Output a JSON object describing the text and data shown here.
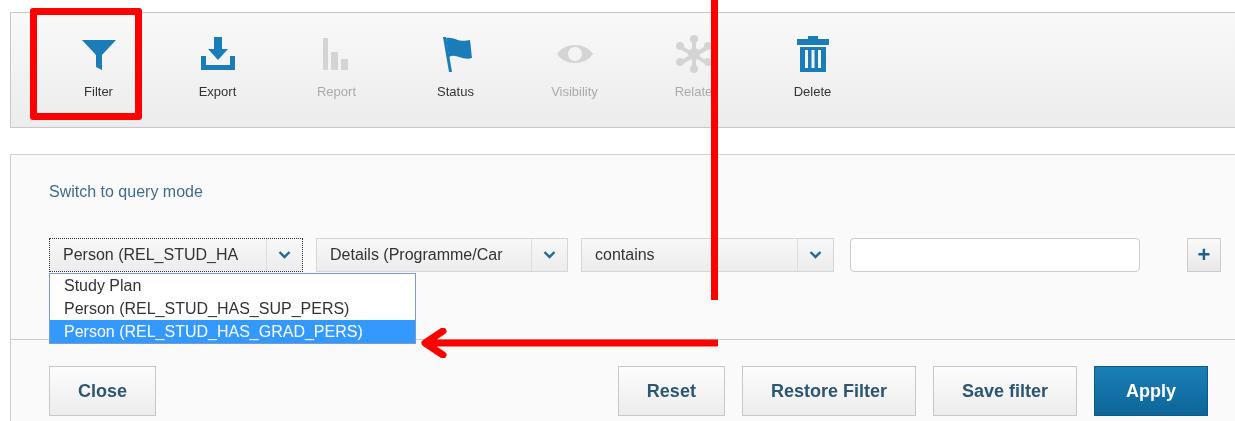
{
  "toolbar": {
    "items": [
      {
        "kind": "filter",
        "label": "Filter",
        "disabled": false
      },
      {
        "kind": "export",
        "label": "Export",
        "disabled": false
      },
      {
        "kind": "report",
        "label": "Report",
        "disabled": true
      },
      {
        "kind": "status",
        "label": "Status",
        "disabled": false
      },
      {
        "kind": "visibility",
        "label": "Visibility",
        "disabled": true
      },
      {
        "kind": "relate",
        "label": "Relate",
        "disabled": true
      },
      {
        "kind": "delete",
        "label": "Delete",
        "disabled": false
      }
    ]
  },
  "filter_panel": {
    "query_mode_link": "Switch to query mode",
    "condition": {
      "field": "Person (REL_STUD_HA",
      "detail": "Details (Programme/Car",
      "operator": "contains",
      "add_button": "+"
    },
    "field_options": [
      {
        "label": "Study Plan",
        "selected": false
      },
      {
        "label": "Person (REL_STUD_HAS_SUP_PERS)",
        "selected": false
      },
      {
        "label": "Person (REL_STUD_HAS_GRAD_PERS)",
        "selected": true
      }
    ],
    "buttons": [
      {
        "label": "Close",
        "kind": "plain"
      },
      {
        "label": "Reset",
        "kind": "plain"
      },
      {
        "label": "Restore Filter",
        "kind": "plain"
      },
      {
        "label": "Save filter",
        "kind": "plain"
      },
      {
        "label": "Apply",
        "kind": "primary"
      }
    ]
  },
  "annotations": [
    {
      "kind": "box"
    },
    {
      "kind": "line"
    },
    {
      "kind": "arrow"
    }
  ]
}
